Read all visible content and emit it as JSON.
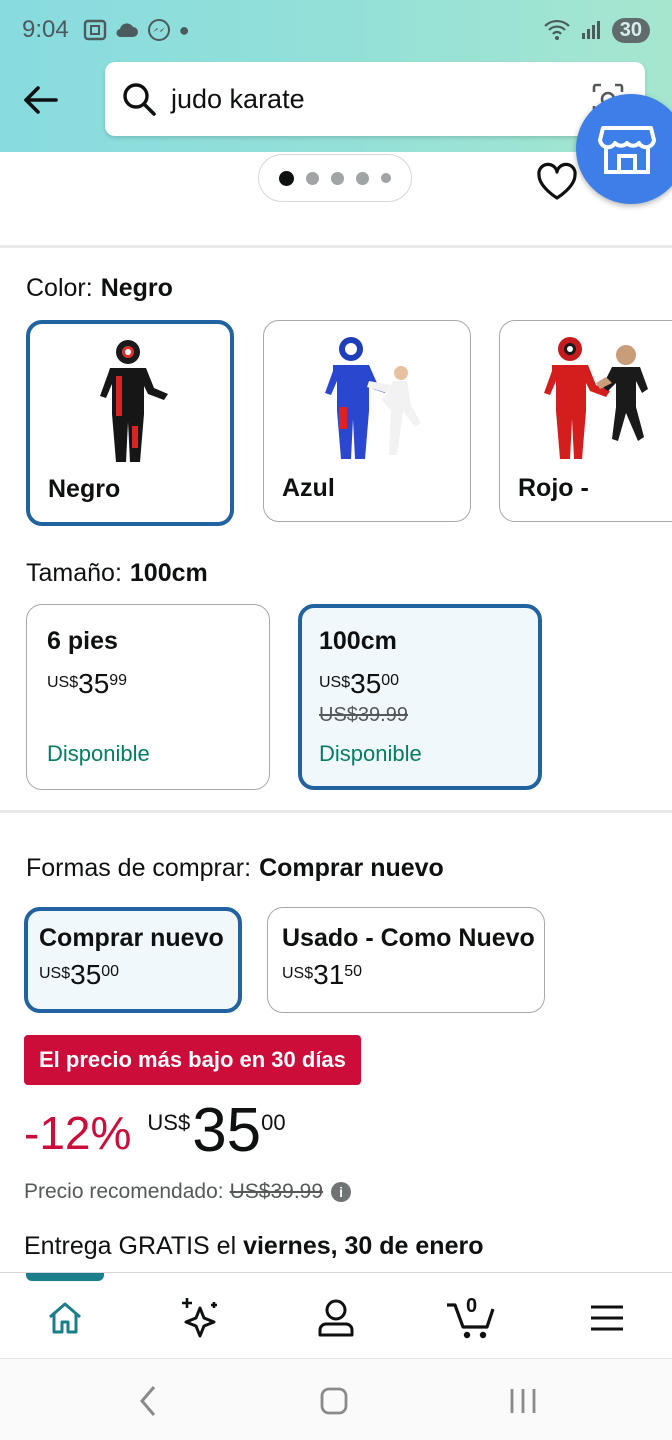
{
  "status_bar": {
    "time": "9:04",
    "battery": "30"
  },
  "search": {
    "query": "judo karate"
  },
  "color": {
    "label": "Color:",
    "selected": "Negro",
    "options": [
      {
        "name": "Negro"
      },
      {
        "name": "Azul"
      },
      {
        "name": "Rojo -"
      }
    ]
  },
  "size": {
    "label": "Tamaño:",
    "selected": "100cm",
    "options": [
      {
        "name": "6 pies",
        "currency": "US$",
        "whole": "35",
        "fraction": "99",
        "list_price": "",
        "availability": "Disponible"
      },
      {
        "name": "100cm",
        "currency": "US$",
        "whole": "35",
        "fraction": "00",
        "list_price": "US$39.99",
        "availability": "Disponible"
      }
    ]
  },
  "buy": {
    "label": "Formas de comprar:",
    "selected": "Comprar nuevo",
    "options": [
      {
        "name": "Comprar nuevo",
        "currency": "US$",
        "whole": "35",
        "fraction": "00"
      },
      {
        "name": "Usado - Como Nuevo",
        "currency": "US$",
        "whole": "31",
        "fraction": "50"
      }
    ]
  },
  "deal_badge": "El precio más bajo en 30 días",
  "price": {
    "discount": "-12%",
    "currency": "US$",
    "whole": "35",
    "fraction": "00"
  },
  "list_price": {
    "label": "Precio recomendado:",
    "value": "US$39.99"
  },
  "delivery": {
    "prefix": "Entrega GRATIS el",
    "date": "viernes, 30 de enero"
  },
  "cart_count": "0",
  "colors": {
    "accent_blue": "#2162a1",
    "deal_red": "#cc0c39",
    "available_green": "#067d62",
    "header_teal": "#88dbdf"
  }
}
